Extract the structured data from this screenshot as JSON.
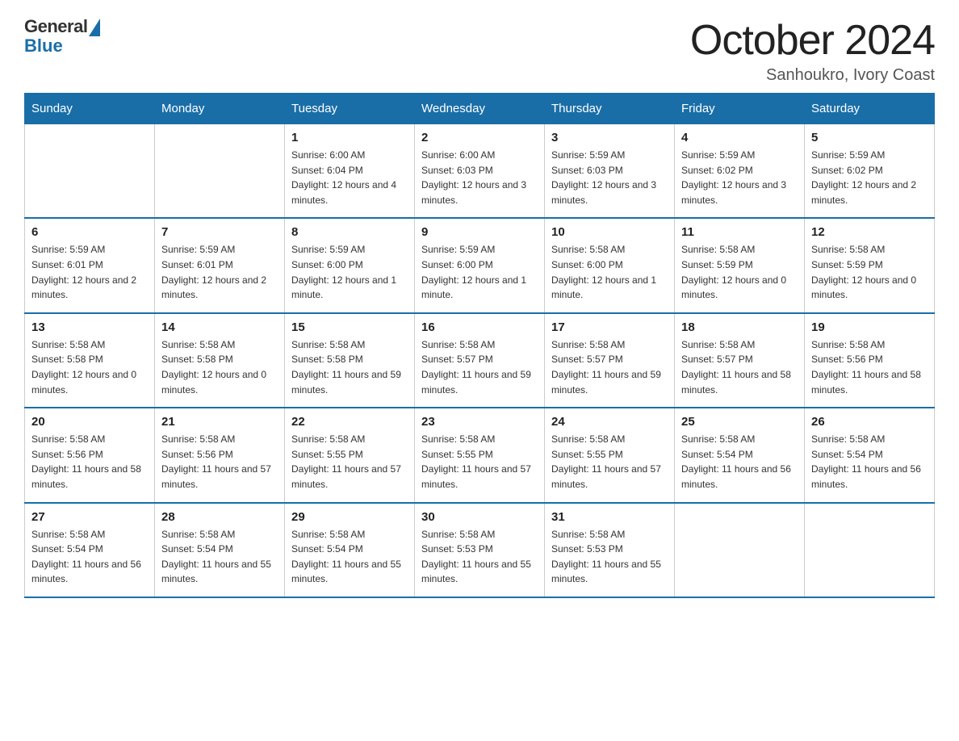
{
  "logo": {
    "general": "General",
    "blue": "Blue"
  },
  "title": "October 2024",
  "subtitle": "Sanhoukro, Ivory Coast",
  "headers": [
    "Sunday",
    "Monday",
    "Tuesday",
    "Wednesday",
    "Thursday",
    "Friday",
    "Saturday"
  ],
  "weeks": [
    [
      {
        "day": "",
        "sunrise": "",
        "sunset": "",
        "daylight": ""
      },
      {
        "day": "",
        "sunrise": "",
        "sunset": "",
        "daylight": ""
      },
      {
        "day": "1",
        "sunrise": "Sunrise: 6:00 AM",
        "sunset": "Sunset: 6:04 PM",
        "daylight": "Daylight: 12 hours and 4 minutes."
      },
      {
        "day": "2",
        "sunrise": "Sunrise: 6:00 AM",
        "sunset": "Sunset: 6:03 PM",
        "daylight": "Daylight: 12 hours and 3 minutes."
      },
      {
        "day": "3",
        "sunrise": "Sunrise: 5:59 AM",
        "sunset": "Sunset: 6:03 PM",
        "daylight": "Daylight: 12 hours and 3 minutes."
      },
      {
        "day": "4",
        "sunrise": "Sunrise: 5:59 AM",
        "sunset": "Sunset: 6:02 PM",
        "daylight": "Daylight: 12 hours and 3 minutes."
      },
      {
        "day": "5",
        "sunrise": "Sunrise: 5:59 AM",
        "sunset": "Sunset: 6:02 PM",
        "daylight": "Daylight: 12 hours and 2 minutes."
      }
    ],
    [
      {
        "day": "6",
        "sunrise": "Sunrise: 5:59 AM",
        "sunset": "Sunset: 6:01 PM",
        "daylight": "Daylight: 12 hours and 2 minutes."
      },
      {
        "day": "7",
        "sunrise": "Sunrise: 5:59 AM",
        "sunset": "Sunset: 6:01 PM",
        "daylight": "Daylight: 12 hours and 2 minutes."
      },
      {
        "day": "8",
        "sunrise": "Sunrise: 5:59 AM",
        "sunset": "Sunset: 6:00 PM",
        "daylight": "Daylight: 12 hours and 1 minute."
      },
      {
        "day": "9",
        "sunrise": "Sunrise: 5:59 AM",
        "sunset": "Sunset: 6:00 PM",
        "daylight": "Daylight: 12 hours and 1 minute."
      },
      {
        "day": "10",
        "sunrise": "Sunrise: 5:58 AM",
        "sunset": "Sunset: 6:00 PM",
        "daylight": "Daylight: 12 hours and 1 minute."
      },
      {
        "day": "11",
        "sunrise": "Sunrise: 5:58 AM",
        "sunset": "Sunset: 5:59 PM",
        "daylight": "Daylight: 12 hours and 0 minutes."
      },
      {
        "day": "12",
        "sunrise": "Sunrise: 5:58 AM",
        "sunset": "Sunset: 5:59 PM",
        "daylight": "Daylight: 12 hours and 0 minutes."
      }
    ],
    [
      {
        "day": "13",
        "sunrise": "Sunrise: 5:58 AM",
        "sunset": "Sunset: 5:58 PM",
        "daylight": "Daylight: 12 hours and 0 minutes."
      },
      {
        "day": "14",
        "sunrise": "Sunrise: 5:58 AM",
        "sunset": "Sunset: 5:58 PM",
        "daylight": "Daylight: 12 hours and 0 minutes."
      },
      {
        "day": "15",
        "sunrise": "Sunrise: 5:58 AM",
        "sunset": "Sunset: 5:58 PM",
        "daylight": "Daylight: 11 hours and 59 minutes."
      },
      {
        "day": "16",
        "sunrise": "Sunrise: 5:58 AM",
        "sunset": "Sunset: 5:57 PM",
        "daylight": "Daylight: 11 hours and 59 minutes."
      },
      {
        "day": "17",
        "sunrise": "Sunrise: 5:58 AM",
        "sunset": "Sunset: 5:57 PM",
        "daylight": "Daylight: 11 hours and 59 minutes."
      },
      {
        "day": "18",
        "sunrise": "Sunrise: 5:58 AM",
        "sunset": "Sunset: 5:57 PM",
        "daylight": "Daylight: 11 hours and 58 minutes."
      },
      {
        "day": "19",
        "sunrise": "Sunrise: 5:58 AM",
        "sunset": "Sunset: 5:56 PM",
        "daylight": "Daylight: 11 hours and 58 minutes."
      }
    ],
    [
      {
        "day": "20",
        "sunrise": "Sunrise: 5:58 AM",
        "sunset": "Sunset: 5:56 PM",
        "daylight": "Daylight: 11 hours and 58 minutes."
      },
      {
        "day": "21",
        "sunrise": "Sunrise: 5:58 AM",
        "sunset": "Sunset: 5:56 PM",
        "daylight": "Daylight: 11 hours and 57 minutes."
      },
      {
        "day": "22",
        "sunrise": "Sunrise: 5:58 AM",
        "sunset": "Sunset: 5:55 PM",
        "daylight": "Daylight: 11 hours and 57 minutes."
      },
      {
        "day": "23",
        "sunrise": "Sunrise: 5:58 AM",
        "sunset": "Sunset: 5:55 PM",
        "daylight": "Daylight: 11 hours and 57 minutes."
      },
      {
        "day": "24",
        "sunrise": "Sunrise: 5:58 AM",
        "sunset": "Sunset: 5:55 PM",
        "daylight": "Daylight: 11 hours and 57 minutes."
      },
      {
        "day": "25",
        "sunrise": "Sunrise: 5:58 AM",
        "sunset": "Sunset: 5:54 PM",
        "daylight": "Daylight: 11 hours and 56 minutes."
      },
      {
        "day": "26",
        "sunrise": "Sunrise: 5:58 AM",
        "sunset": "Sunset: 5:54 PM",
        "daylight": "Daylight: 11 hours and 56 minutes."
      }
    ],
    [
      {
        "day": "27",
        "sunrise": "Sunrise: 5:58 AM",
        "sunset": "Sunset: 5:54 PM",
        "daylight": "Daylight: 11 hours and 56 minutes."
      },
      {
        "day": "28",
        "sunrise": "Sunrise: 5:58 AM",
        "sunset": "Sunset: 5:54 PM",
        "daylight": "Daylight: 11 hours and 55 minutes."
      },
      {
        "day": "29",
        "sunrise": "Sunrise: 5:58 AM",
        "sunset": "Sunset: 5:54 PM",
        "daylight": "Daylight: 11 hours and 55 minutes."
      },
      {
        "day": "30",
        "sunrise": "Sunrise: 5:58 AM",
        "sunset": "Sunset: 5:53 PM",
        "daylight": "Daylight: 11 hours and 55 minutes."
      },
      {
        "day": "31",
        "sunrise": "Sunrise: 5:58 AM",
        "sunset": "Sunset: 5:53 PM",
        "daylight": "Daylight: 11 hours and 55 minutes."
      },
      {
        "day": "",
        "sunrise": "",
        "sunset": "",
        "daylight": ""
      },
      {
        "day": "",
        "sunrise": "",
        "sunset": "",
        "daylight": ""
      }
    ]
  ]
}
